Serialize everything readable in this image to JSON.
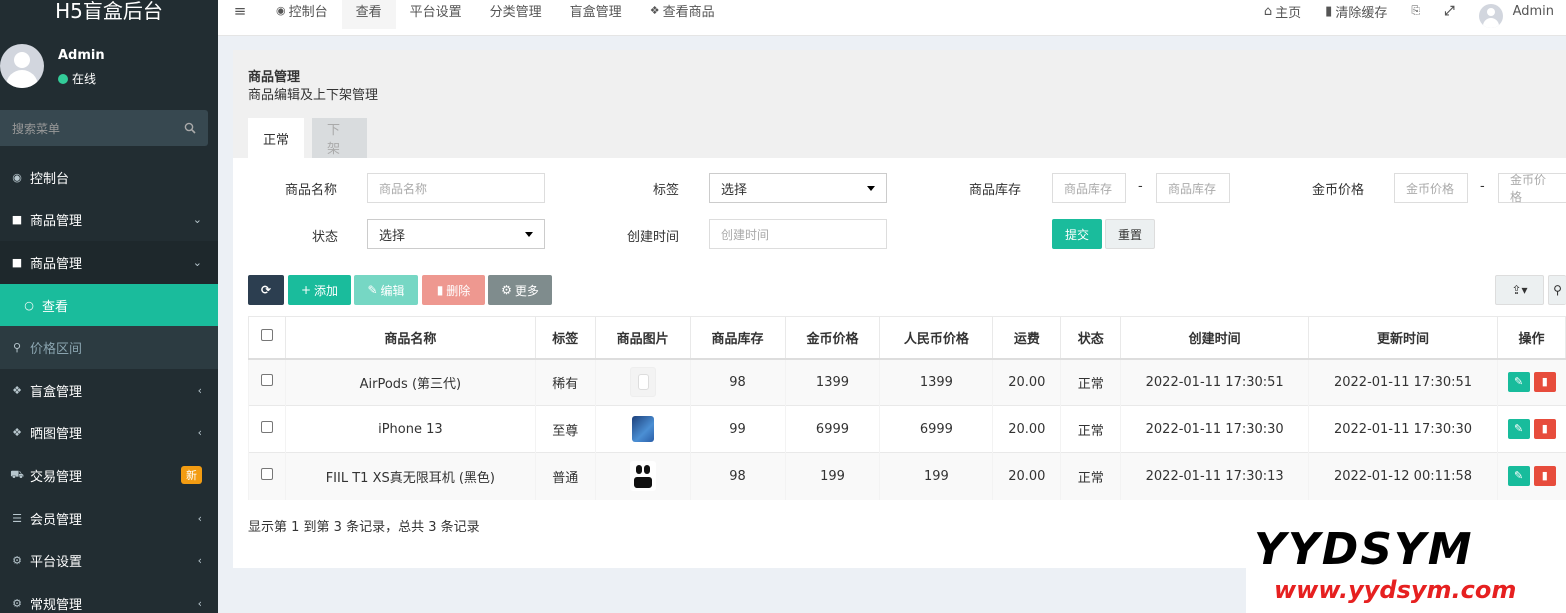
{
  "brand": "H5盲盒后台",
  "user": {
    "name": "Admin",
    "status": "在线"
  },
  "sidebar": {
    "search_placeholder": "搜索菜单",
    "items": [
      {
        "label": "控制台",
        "icon": "dashboard-icon"
      },
      {
        "label": "商品管理",
        "icon": "shopping-bag-icon"
      },
      {
        "label": "商品管理",
        "icon": "shopping-bag-icon"
      },
      {
        "label": "查看",
        "icon": "circle-icon"
      },
      {
        "label": "价格区间",
        "icon": "search-icon"
      },
      {
        "label": "盲盒管理",
        "icon": "dropbox-icon"
      },
      {
        "label": "晒图管理",
        "icon": "dropbox-icon"
      },
      {
        "label": "交易管理",
        "icon": "cart-icon",
        "badge": "新"
      },
      {
        "label": "会员管理",
        "icon": "list-icon"
      },
      {
        "label": "平台设置",
        "icon": "gears-icon"
      },
      {
        "label": "常规管理",
        "icon": "gears-icon"
      }
    ]
  },
  "topbar": {
    "tabs": [
      "控制台",
      "查看",
      "平台设置",
      "分类管理",
      "盲盒管理",
      "查看商品"
    ],
    "home": "主页",
    "clear_cache": "清除缓存",
    "admin": "Admin"
  },
  "panel": {
    "title": "商品管理",
    "subtitle": "商品编辑及上下架管理",
    "tabs": [
      "正常",
      "下架"
    ]
  },
  "filters": {
    "name_label": "商品名称",
    "name_placeholder": "商品名称",
    "tag_label": "标签",
    "tag_value": "选择",
    "stock_label": "商品库存",
    "stock_placeholder": "商品库存",
    "coin_label": "金币价格",
    "coin_placeholder": "金币价格",
    "status_label": "状态",
    "status_value": "选择",
    "created_label": "创建时间",
    "created_placeholder": "创建时间",
    "dash": "-",
    "submit": "提交",
    "reset": "重置"
  },
  "toolbar": {
    "add": "添加",
    "edit": "编辑",
    "delete": "删除",
    "more": "更多"
  },
  "table": {
    "headers": [
      "商品名称",
      "标签",
      "商品图片",
      "商品库存",
      "金币价格",
      "人民币价格",
      "运费",
      "状态",
      "创建时间",
      "更新时间",
      "操作"
    ],
    "rows": [
      {
        "name": "AirPods (第三代)",
        "tag": "稀有",
        "stock": "98",
        "coin": "1399",
        "rmb": "1399",
        "freight": "20.00",
        "status": "正常",
        "created": "2022-01-11 17:30:51",
        "updated": "2022-01-11 17:30:51"
      },
      {
        "name": "iPhone 13",
        "tag": "至尊",
        "stock": "99",
        "coin": "6999",
        "rmb": "6999",
        "freight": "20.00",
        "status": "正常",
        "created": "2022-01-11 17:30:30",
        "updated": "2022-01-11 17:30:30"
      },
      {
        "name": "FIIL T1 XS真无限耳机 (黑色)",
        "tag": "普通",
        "stock": "98",
        "coin": "199",
        "rmb": "199",
        "freight": "20.00",
        "status": "正常",
        "created": "2022-01-11 17:30:13",
        "updated": "2022-01-12 00:11:58"
      }
    ]
  },
  "pager": "显示第 1 到第 3 条记录，总共 3 条记录",
  "watermark": {
    "logo": "YYDSYM",
    "url": "www.yydsym.com"
  },
  "colors": {
    "sidebar": "#222d32",
    "accent": "#1abc9c",
    "danger": "#e74c3c"
  }
}
